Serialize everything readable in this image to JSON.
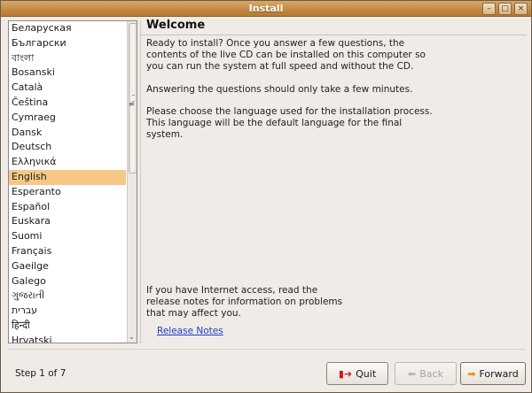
{
  "window": {
    "title": "Install",
    "minimize": "–",
    "maximize": "□",
    "close": "×"
  },
  "languages": {
    "items": [
      "Беларуская",
      "Български",
      "বাংলা",
      "Bosanski",
      "Català",
      "Čeština",
      "Cymraeg",
      "Dansk",
      "Deutsch",
      "Ελληνικά",
      "English",
      "Esperanto",
      "Español",
      "Euskara",
      "Suomi",
      "Français",
      "Gaeilge",
      "Galego",
      "ગુજરાતી",
      "עברית",
      "हिन्दी",
      "Hrvatski"
    ],
    "selected": "English"
  },
  "main": {
    "title": "Welcome",
    "para1": "Ready to install? Once you answer a few questions, the contents of the live CD can be installed on this computer so you can run the system at full speed and without the CD.",
    "para2": "Answering the questions should only take a few minutes.",
    "para3": "Please choose the language used for the installation process. This language will be the default language for the final system.",
    "para4": "If you have Internet access, read the release notes for information on problems that may affect you.",
    "release_notes": "Release Notes"
  },
  "footer": {
    "step": "Step 1 of 7",
    "quit": "Quit",
    "back": "Back",
    "forward": "Forward"
  },
  "icons": {
    "quit": "quit-door-icon",
    "back": "arrow-left-icon",
    "forward": "arrow-right-icon"
  }
}
